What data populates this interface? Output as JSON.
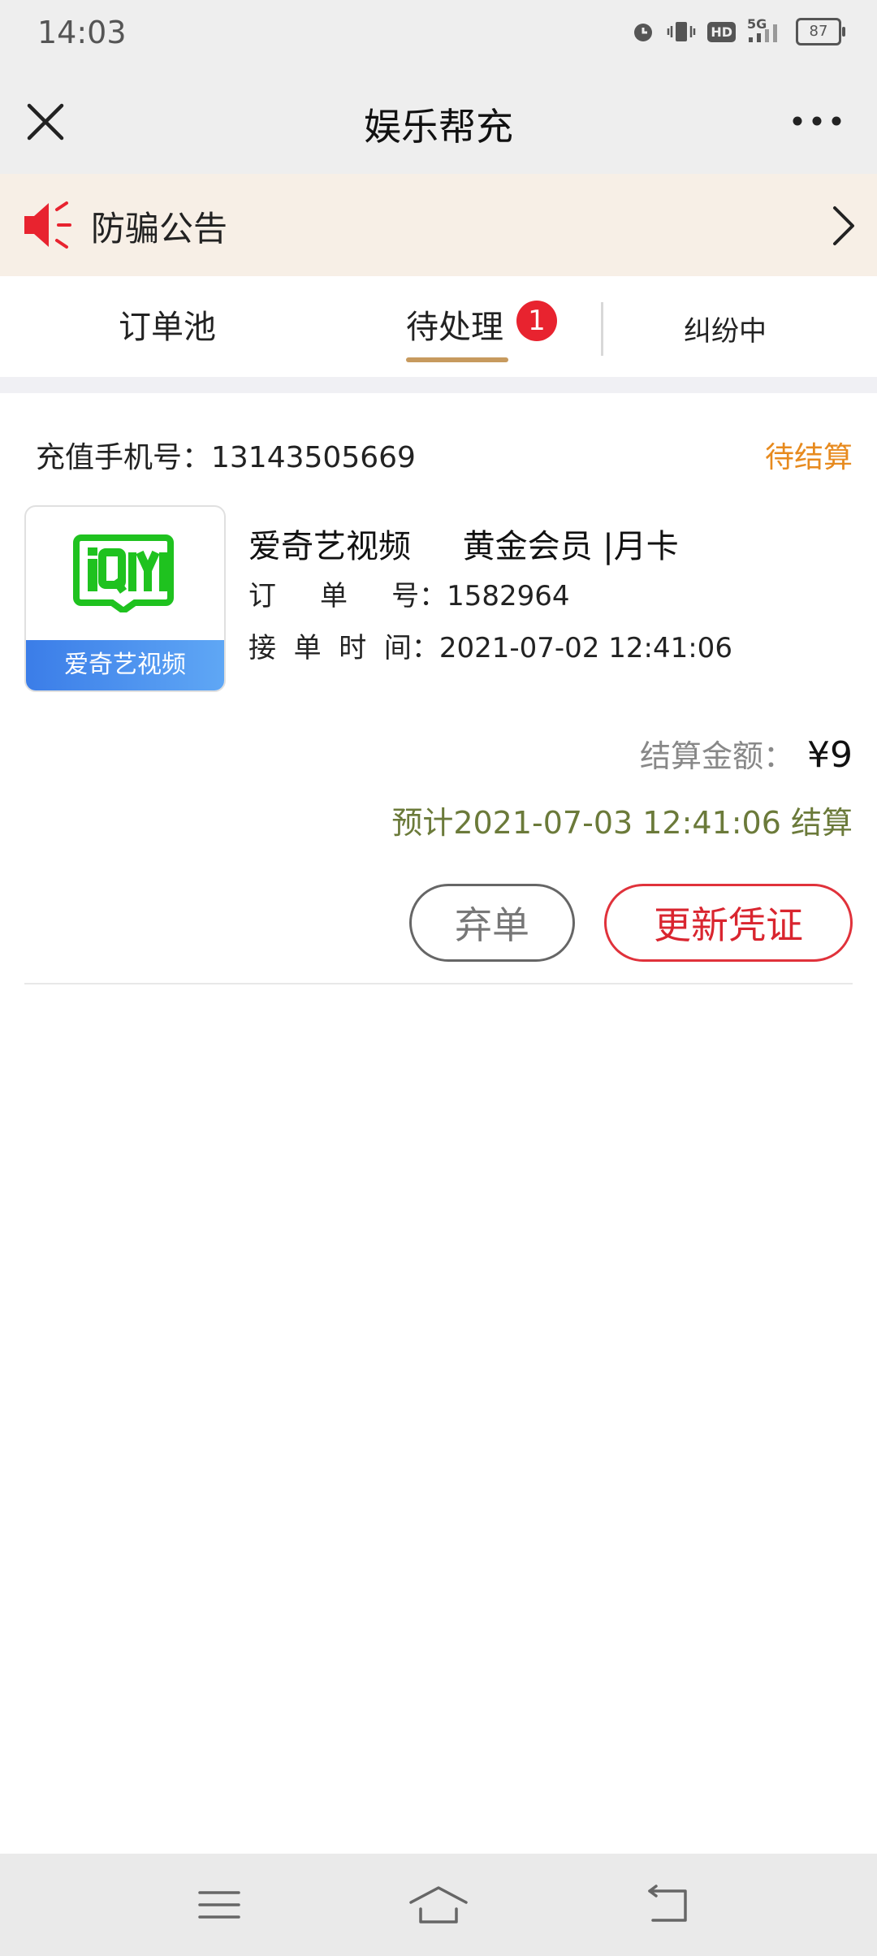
{
  "status_bar": {
    "time": "14:03",
    "battery": "87",
    "network": "5G",
    "hd": "HD"
  },
  "titlebar": {
    "title": "娱乐帮充"
  },
  "notice": {
    "text": "防骗公告"
  },
  "tabs": [
    {
      "label": "订单池"
    },
    {
      "label": "待处理",
      "badge": "1"
    },
    {
      "label": "纠纷中"
    }
  ],
  "order": {
    "phone_label": "充值手机号：13143505669",
    "status": "待结算",
    "logo_label": "爱奇艺视频",
    "product_title": "爱奇艺视频     黄金会员 |月卡",
    "order_no": "订     单     号：1582964",
    "order_time": "接  单  时  间：2021-07-02 12:41:06",
    "amount_label": "结算金额：",
    "amount_value": "¥9",
    "settle_note": "预计2021-07-03 12:41:06 结算",
    "btn_abandon": "弃单",
    "btn_update": "更新凭证"
  },
  "colors": {
    "accent_tab": "#c79a5e",
    "status_orange": "#e78a1e",
    "badge_red": "#e8232f",
    "update_red": "#d9252f",
    "settle_green": "#6b7a3a",
    "notice_bg": "#f7efe6",
    "iqiyi_green": "#1fc21f"
  }
}
